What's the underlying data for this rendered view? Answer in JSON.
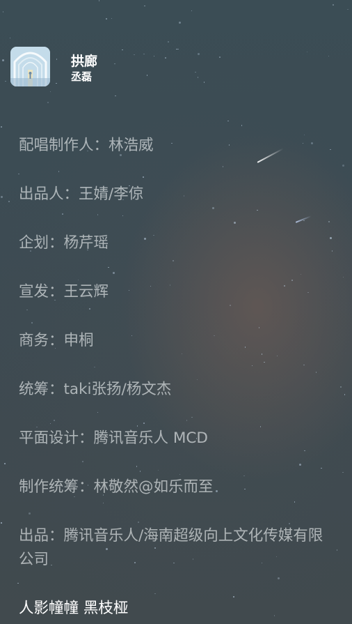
{
  "song": {
    "title": "拱廊",
    "artist": "丞磊"
  },
  "lyrics": [
    "配唱制作人：林浩威",
    "出品人：王婧/李倞",
    "企划：杨芹瑶",
    "宣发：王云辉",
    "商务：申桐",
    "统筹：taki张扬/杨文杰",
    "平面设计：腾讯音乐人 MCD",
    "制作统筹：林敬然@如乐而至",
    "出品：腾讯音乐人/海南超级向上文化传媒有限公司",
    "人影幢幢 黑枝桠"
  ],
  "colors": {
    "background": "#3b4d55",
    "lyric_inactive": "#c9cfd2",
    "lyric_active": "#ffffff"
  }
}
